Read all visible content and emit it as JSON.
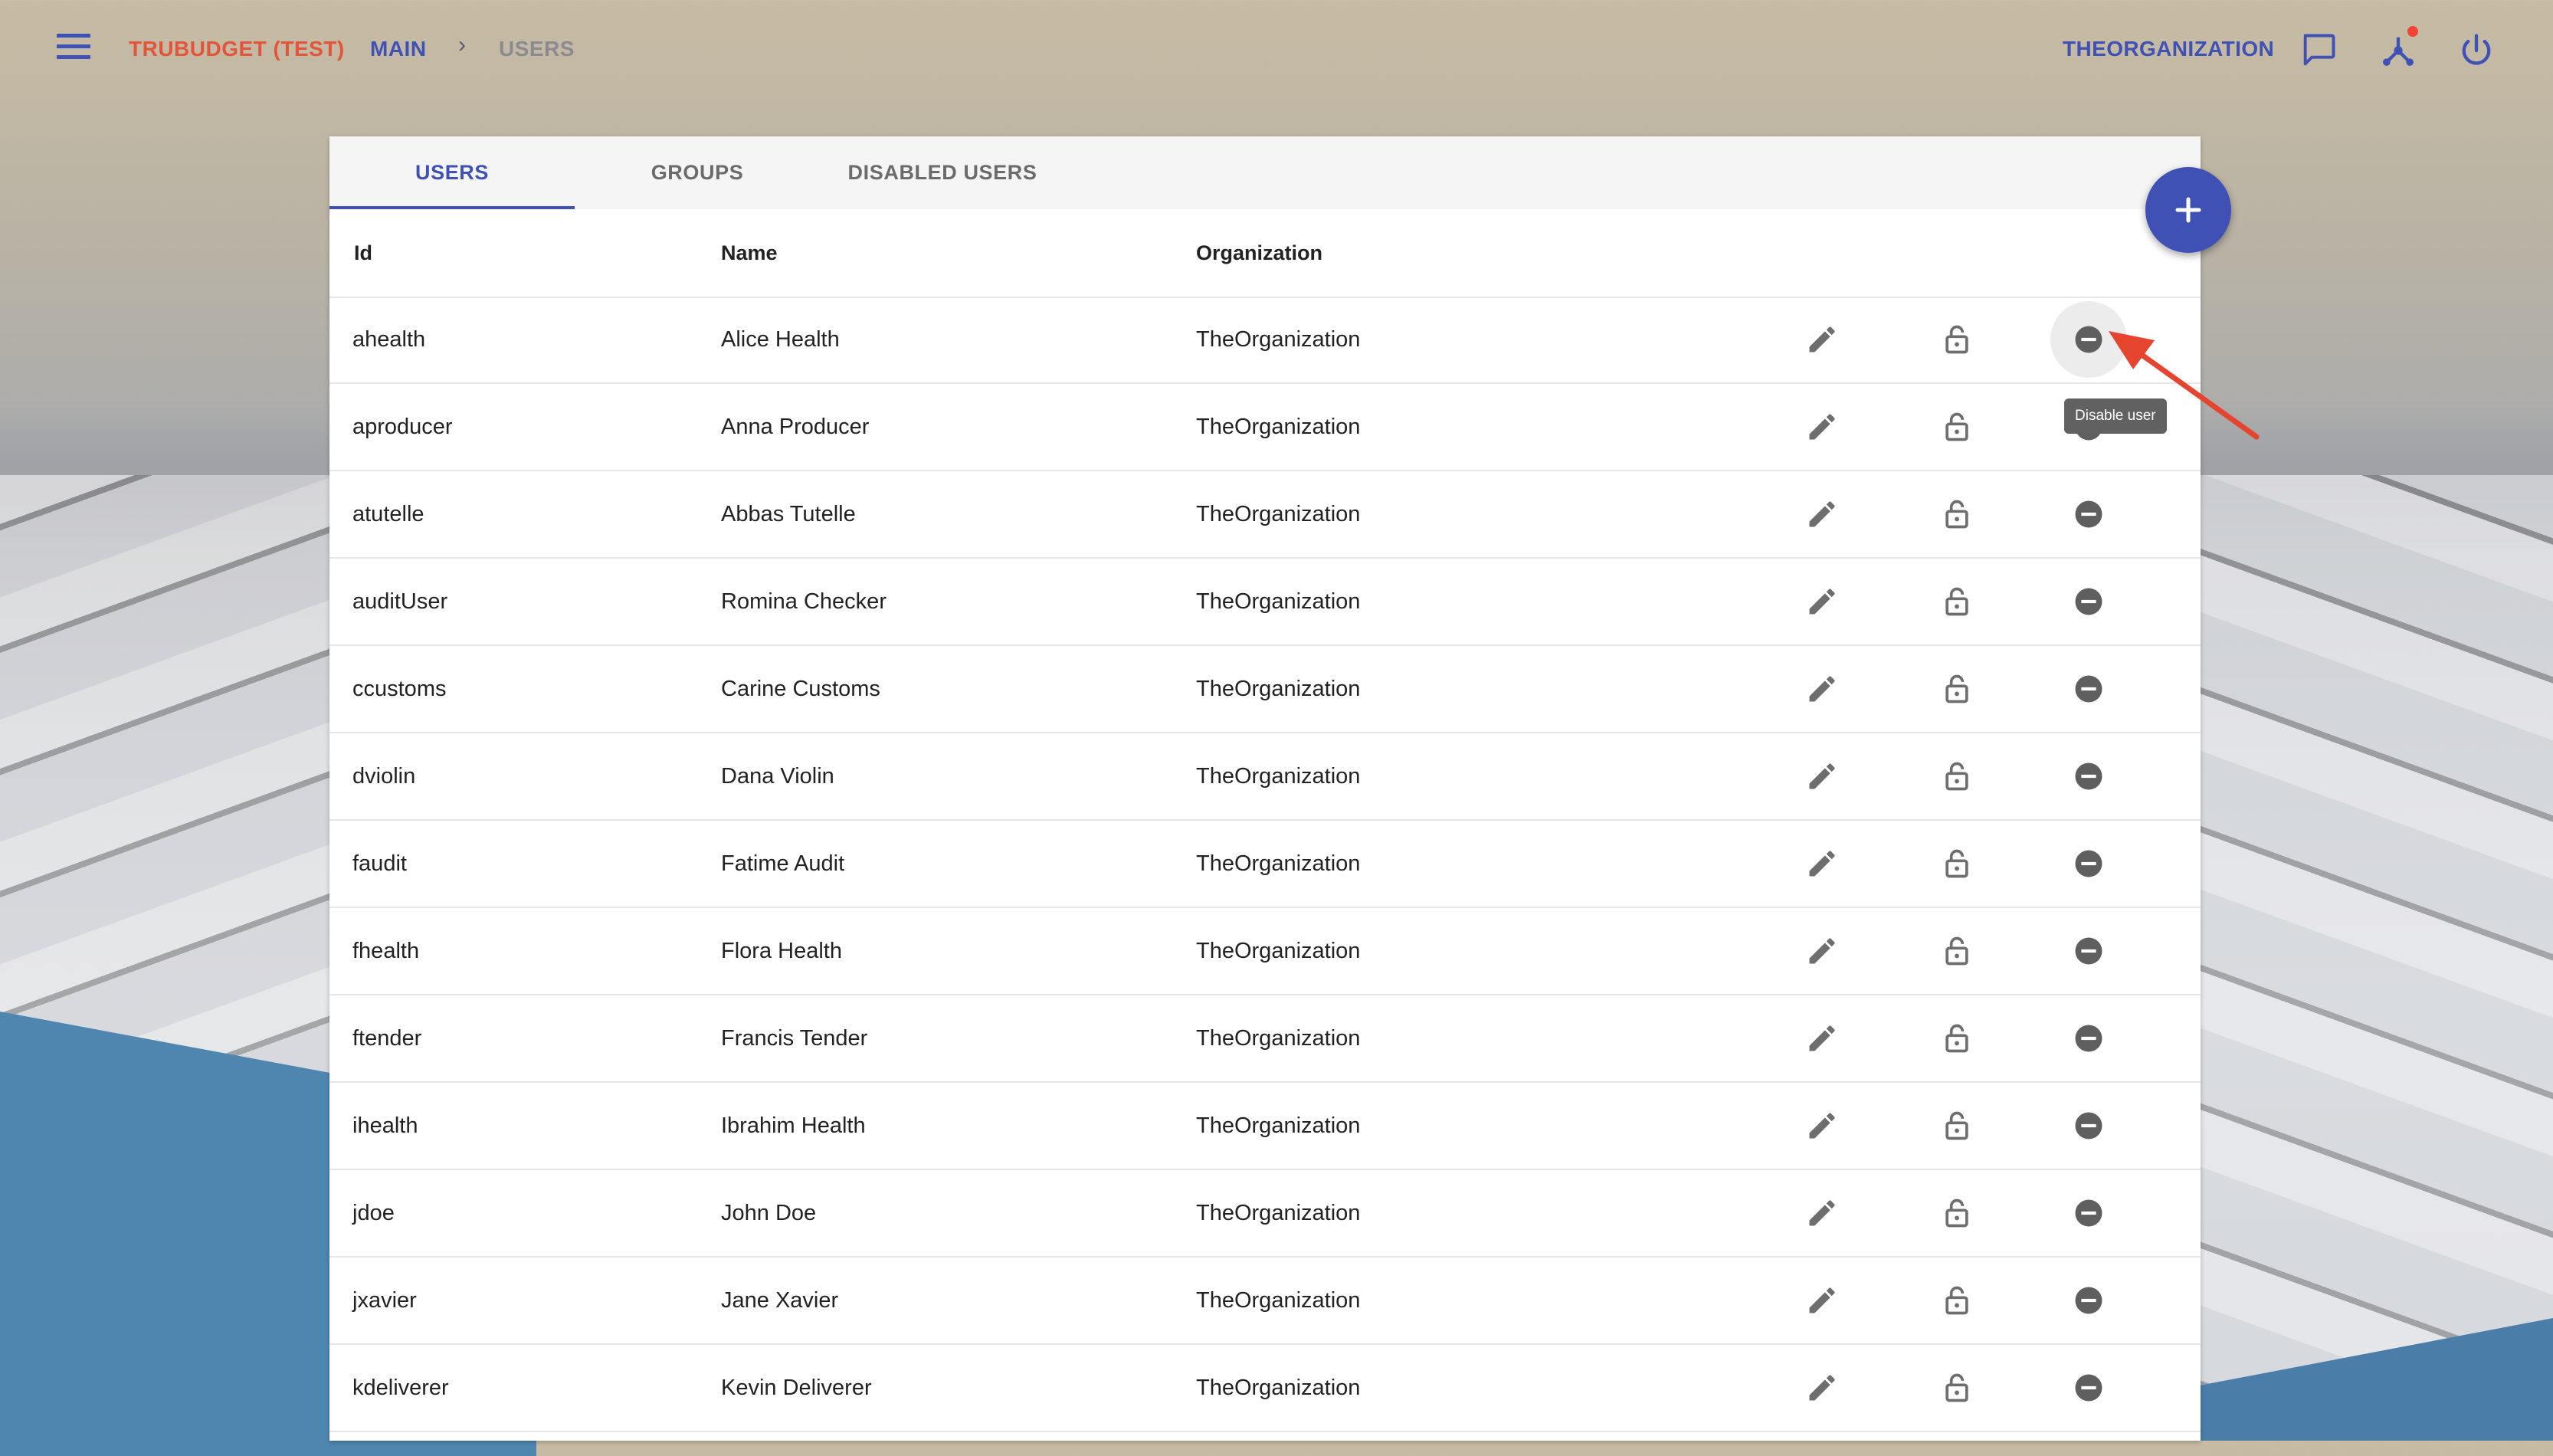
{
  "header": {
    "app_name": "TRUBUDGET (TEST)",
    "breadcrumb_main": "MAIN",
    "breadcrumb_separator": "›",
    "breadcrumb_current": "USERS",
    "organization": "THEORGANIZATION",
    "icons": [
      "menu-icon",
      "chat-icon",
      "network-icon",
      "power-icon"
    ],
    "accent_color": "#3f51b5",
    "app_name_color": "#e2553a",
    "network_notification": true
  },
  "tabs": [
    {
      "label": "USERS",
      "active": true
    },
    {
      "label": "GROUPS",
      "active": false
    },
    {
      "label": "DISABLED USERS",
      "active": false
    }
  ],
  "table": {
    "columns": [
      "Id",
      "Name",
      "Organization"
    ],
    "rows": [
      {
        "id": "ahealth",
        "name": "Alice Health",
        "organization": "TheOrganization"
      },
      {
        "id": "aproducer",
        "name": "Anna Producer",
        "organization": "TheOrganization"
      },
      {
        "id": "atutelle",
        "name": "Abbas Tutelle",
        "organization": "TheOrganization"
      },
      {
        "id": "auditUser",
        "name": "Romina Checker",
        "organization": "TheOrganization"
      },
      {
        "id": "ccustoms",
        "name": "Carine Customs",
        "organization": "TheOrganization"
      },
      {
        "id": "dviolin",
        "name": "Dana Violin",
        "organization": "TheOrganization"
      },
      {
        "id": "faudit",
        "name": "Fatime Audit",
        "organization": "TheOrganization"
      },
      {
        "id": "fhealth",
        "name": "Flora Health",
        "organization": "TheOrganization"
      },
      {
        "id": "ftender",
        "name": "Francis Tender",
        "organization": "TheOrganization"
      },
      {
        "id": "ihealth",
        "name": "Ibrahim Health",
        "organization": "TheOrganization"
      },
      {
        "id": "jdoe",
        "name": "John Doe",
        "organization": "TheOrganization"
      },
      {
        "id": "jxavier",
        "name": "Jane Xavier",
        "organization": "TheOrganization"
      },
      {
        "id": "kdeliverer",
        "name": "Kevin Deliverer",
        "organization": "TheOrganization"
      }
    ],
    "row_actions": [
      "edit-icon",
      "lock-icon",
      "disable-user-icon"
    ]
  },
  "fab": {
    "icon": "plus-icon"
  },
  "tooltip": {
    "text": "Disable user"
  },
  "annotation_color": "#e5452f"
}
